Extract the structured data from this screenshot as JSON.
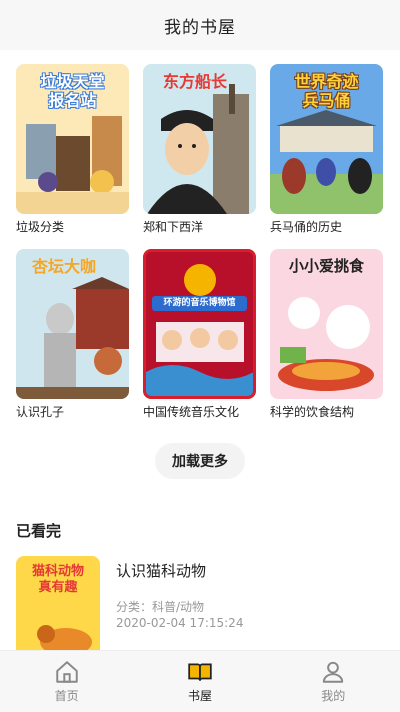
{
  "header": {
    "title": "我的书屋"
  },
  "books": [
    {
      "cover_text": "垃圾天堂\n报名站",
      "label": "垃圾分类",
      "theme": "c1"
    },
    {
      "cover_text": "东方船长",
      "label": "郑和下西洋",
      "theme": "c2"
    },
    {
      "cover_text": "世界奇迹\n兵马俑",
      "label": "兵马俑的历史",
      "theme": "c3"
    },
    {
      "cover_text": "杏坛大咖",
      "label": "认识孔子",
      "theme": "c4"
    },
    {
      "cover_text": "环游的音乐博物馆",
      "label": "中国传统音乐文化",
      "theme": "c5"
    },
    {
      "cover_text": "小小爱挑食",
      "label": "科学的饮食结构",
      "theme": "c6"
    }
  ],
  "load_more": "加载更多",
  "finished": {
    "section_title": "已看完",
    "item": {
      "cover_text": "猫科动物\n真有趣",
      "title": "认识猫科动物",
      "category": "分类：科普/动物",
      "time": "2020-02-04 17:15:24"
    }
  },
  "tabs": [
    {
      "label": "首页",
      "icon": "home-icon"
    },
    {
      "label": "书屋",
      "icon": "book-icon",
      "active": true
    },
    {
      "label": "我的",
      "icon": "user-icon"
    }
  ],
  "colors": {
    "accent": "#f5b400"
  }
}
